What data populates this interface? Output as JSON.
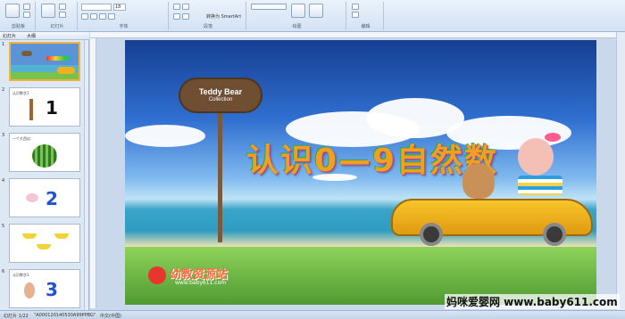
{
  "ribbon": {
    "groups": [
      {
        "label": "剪贴板"
      },
      {
        "label": "幻灯片"
      },
      {
        "label": "字体"
      },
      {
        "label": "段落"
      },
      {
        "label": "绘图"
      },
      {
        "label": "编辑"
      }
    ],
    "smallart_label": "转换为 SmartArt",
    "font_size": "18"
  },
  "sidebar": {
    "tabs": [
      "幻灯片",
      "大纲"
    ],
    "slides": [
      {
        "num": "1",
        "title": "",
        "digit": ""
      },
      {
        "num": "2",
        "title": "认识数字1",
        "digit": "1"
      },
      {
        "num": "3",
        "title": "一个大西瓜",
        "digit": ""
      },
      {
        "num": "4",
        "title": "",
        "digit": "2"
      },
      {
        "num": "5",
        "title": "",
        "digit": ""
      },
      {
        "num": "6",
        "title": "认识数字3",
        "digit": "3"
      }
    ]
  },
  "slide": {
    "sign_line1": "Teddy Bear",
    "sign_line2": "Collection",
    "title": "认识0—9自然数",
    "logo_text": "幼教资源站",
    "logo_url": "www.baby611.com"
  },
  "watermark": "妈咪爱婴网 www.baby611.com",
  "status": {
    "slide_pos": "幻灯片 1/22",
    "theme": "\"A000120140530A99PPBG\"",
    "lang": "中文(中国)"
  }
}
